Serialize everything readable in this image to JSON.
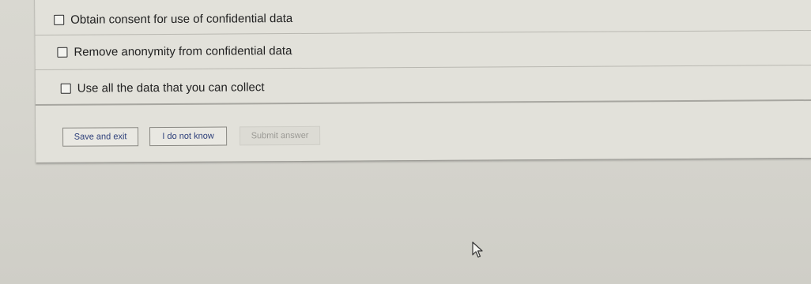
{
  "options": [
    {
      "label": "Obtain consent for use of confidential data",
      "checked": false
    },
    {
      "label": "Remove anonymity from confidential data",
      "checked": false
    },
    {
      "label": "Use all the data that you can collect",
      "checked": false
    }
  ],
  "buttons": {
    "save_exit": "Save and exit",
    "dont_know": "I do not know",
    "submit": "Submit answer"
  },
  "icons": [
    "checkbox-icon",
    "mouse-cursor-icon"
  ],
  "colors": {
    "button_text": "#2d3f7a",
    "disabled_text": "#9c9b96",
    "card": "#e2e1da"
  }
}
